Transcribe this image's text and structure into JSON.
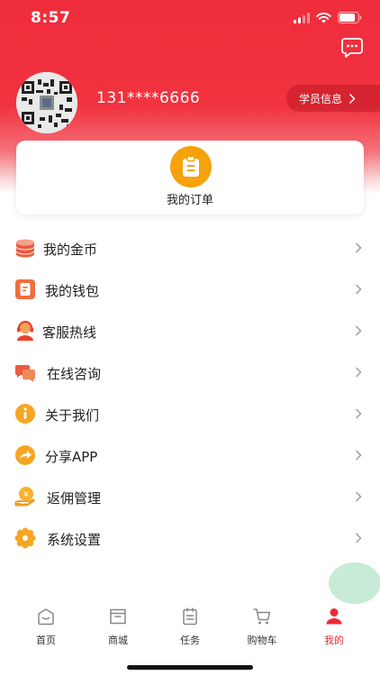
{
  "status_bar": {
    "time": "8:57"
  },
  "profile": {
    "phone": "131****6666",
    "student_info_label": "学员信息"
  },
  "orders": {
    "label": "我的订单"
  },
  "menu": [
    {
      "label": "我的金币",
      "icon": "coins-icon"
    },
    {
      "label": "我的钱包",
      "icon": "wallet-icon"
    },
    {
      "label": "客服热线",
      "icon": "customer-service-icon"
    },
    {
      "label": "在线咨询",
      "icon": "chat-bubbles-icon"
    },
    {
      "label": "关于我们",
      "icon": "info-icon"
    },
    {
      "label": "分享APP",
      "icon": "share-icon"
    },
    {
      "label": "返佣管理",
      "icon": "rebate-icon"
    },
    {
      "label": "系统设置",
      "icon": "settings-icon"
    }
  ],
  "tabs": [
    {
      "label": "首页",
      "icon": "home-icon",
      "active": false
    },
    {
      "label": "商城",
      "icon": "store-icon",
      "active": false
    },
    {
      "label": "任务",
      "icon": "task-icon",
      "active": false
    },
    {
      "label": "购物车",
      "icon": "cart-icon",
      "active": false
    },
    {
      "label": "我的",
      "icon": "profile-icon",
      "active": true
    }
  ],
  "colors": {
    "brand_red": "#ef2d3c",
    "active_tab": "#ee2a36",
    "order_icon": "#f6a20b"
  }
}
